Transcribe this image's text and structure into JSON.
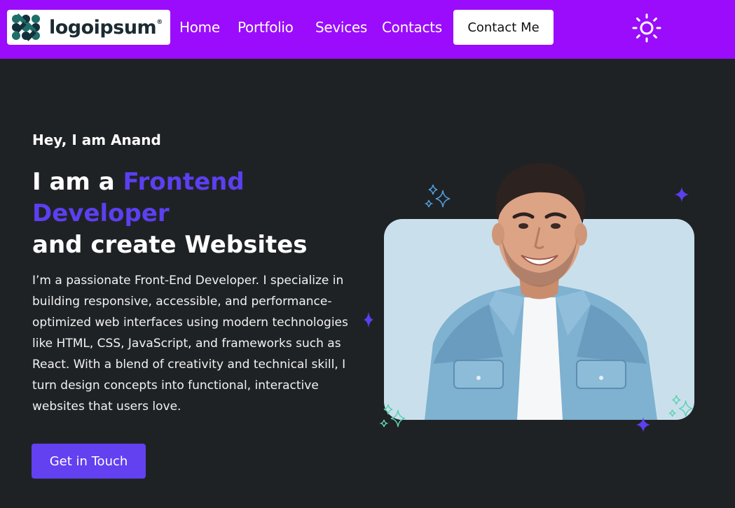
{
  "nav": {
    "logo_text": "logoipsum",
    "logo_mark": "®",
    "links": [
      "Home",
      "Portfolio",
      "Sevices",
      "Contacts"
    ],
    "contact_button": "Contact Me",
    "theme_icon": "sun-icon"
  },
  "hero": {
    "greeting": "Hey, I am Anand",
    "headline_prefix": "I am a ",
    "headline_accent": "Frontend Developer",
    "headline_suffix": "and create Websites",
    "bio": "I’m a passionate Front-End Developer. I specialize in building responsive, accessible, and performance-optimized web interfaces using modern technologies like HTML, CSS, JavaScript, and frameworks such as React. With a blend of creativity and technical skill, I turn design concepts into functional, interactive websites that users love.",
    "cta": "Get in Touch"
  },
  "colors": {
    "nav_bg": "#9a0cfb",
    "page_bg": "#1f2225",
    "accent": "#5b3ff0",
    "card_bg": "#c9e0ec"
  }
}
